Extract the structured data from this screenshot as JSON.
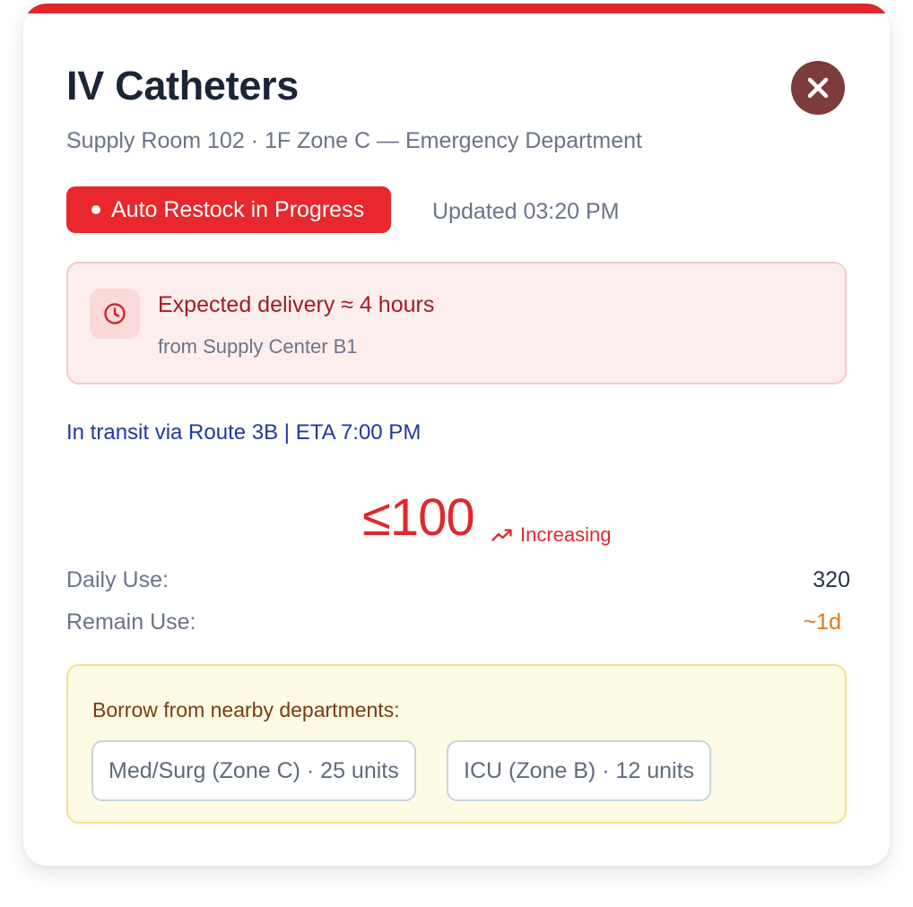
{
  "item": {
    "title": "IV Catheters",
    "location": "Supply Room 102 · 1F Zone C — Emergency Department"
  },
  "status": {
    "badge_label": "Auto Restock in Progress",
    "updated_text": "Updated 03:20 PM",
    "badge_color": "#e8282c"
  },
  "delivery": {
    "icon": "clock-icon",
    "title": "Expected delivery ≈ 4 hours",
    "source": "from Supply Center B1"
  },
  "transit_text": "In transit via Route 3B | ETA 7:00 PM",
  "stock": {
    "value": "≤100",
    "trend_icon": "trending-up-icon",
    "trend_label": "Increasing"
  },
  "metrics": {
    "daily_use_label": "Daily Use:",
    "daily_use_value": "320",
    "remain_use_label": "Remain Use:",
    "remain_use_value": "~1d"
  },
  "borrow": {
    "title": "Borrow from nearby departments:",
    "options": [
      "Med/Surg (Zone C) · 25 units",
      "ICU (Zone B) · 12 units"
    ]
  },
  "colors": {
    "accent_red": "#e0262c",
    "close_button": "#7b3c3a",
    "transit_blue": "#2038a4",
    "remain_orange": "#e07a12"
  }
}
